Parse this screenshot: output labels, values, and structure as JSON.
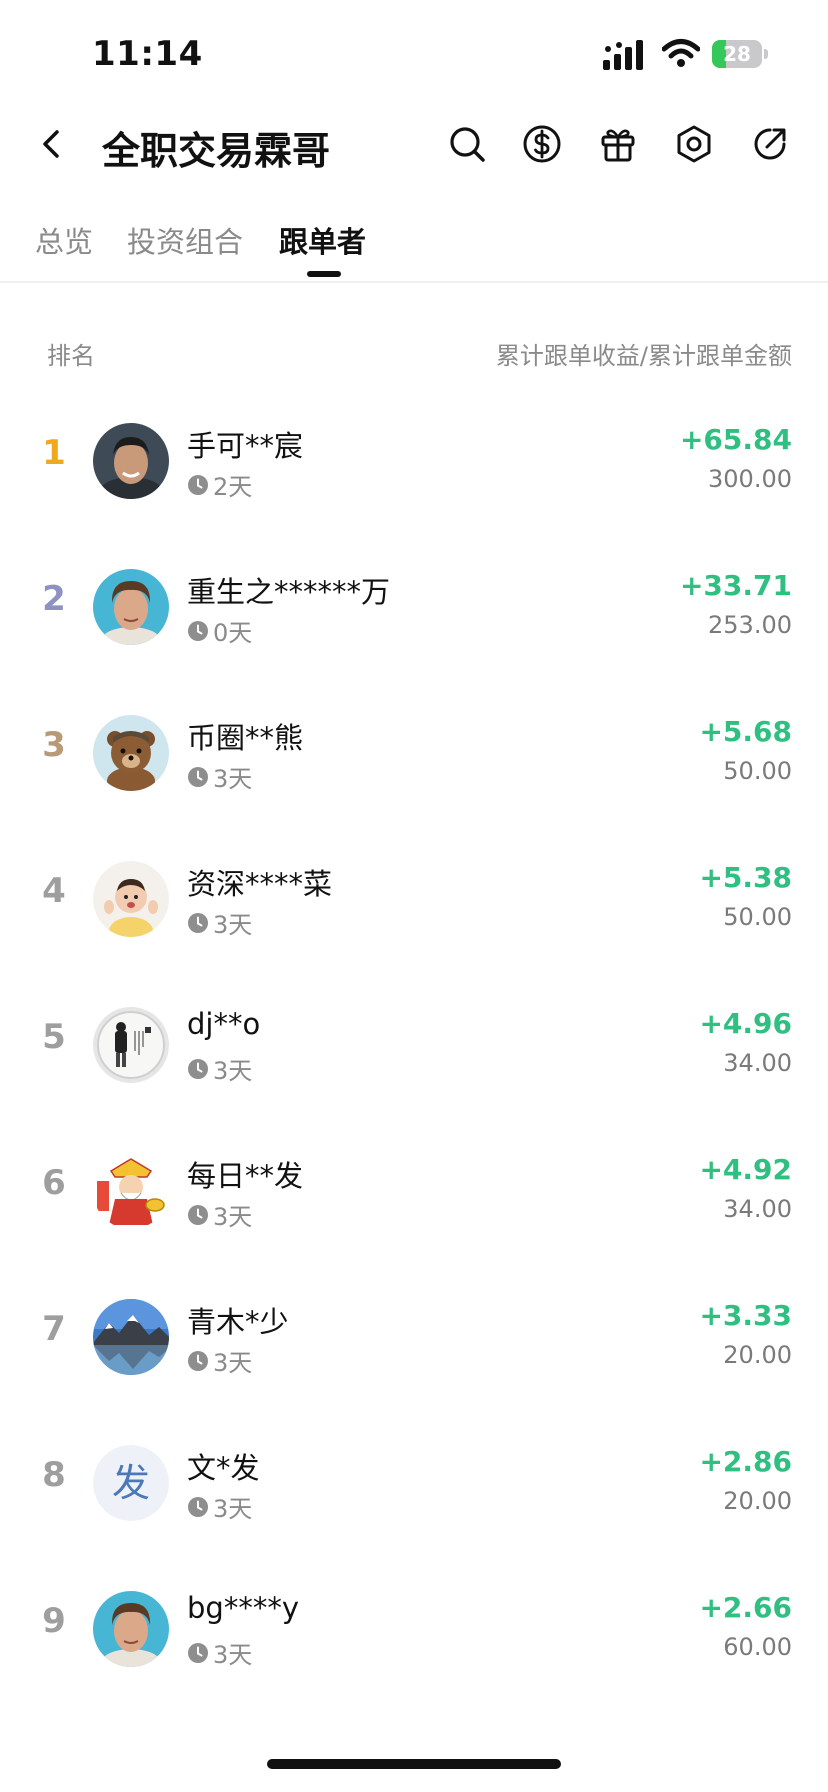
{
  "status_bar": {
    "time": "11:14",
    "battery_level": "28",
    "battery_fraction": 0.28,
    "battery_color": "#34c759",
    "icons": [
      "signal-icon",
      "wifi-icon",
      "battery-icon"
    ]
  },
  "header": {
    "title": "全职交易霖哥",
    "icons": [
      "back-icon",
      "search-icon",
      "dollar-icon",
      "gift-icon",
      "settings-icon",
      "share-icon"
    ]
  },
  "tabs": [
    {
      "label": "总览",
      "active": false
    },
    {
      "label": "投资组合",
      "active": false
    },
    {
      "label": "跟单者",
      "active": true
    }
  ],
  "list_header": {
    "left": "排名",
    "right": "累计跟单收益/累计跟单金额"
  },
  "colors": {
    "profit": "#2fbf80",
    "rank_1": "#f0a81e",
    "rank_2": "#8e92c2",
    "rank_3": "#b89a78",
    "rank_default": "#9e9e9e"
  },
  "followers": [
    {
      "rank": "1",
      "name": "手可**宸",
      "days": "2天",
      "profit": "+65.84",
      "amount": "300.00",
      "avatar": "man-photo"
    },
    {
      "rank": "2",
      "name": "重生之******万",
      "days": "0天",
      "profit": "+33.71",
      "amount": "253.00",
      "avatar": "young-man-photo"
    },
    {
      "rank": "3",
      "name": "币圈**熊",
      "days": "3天",
      "profit": "+5.68",
      "amount": "50.00",
      "avatar": "bear-cartoon"
    },
    {
      "rank": "4",
      "name": "资深****菜",
      "days": "3天",
      "profit": "+5.38",
      "amount": "50.00",
      "avatar": "baby-photo"
    },
    {
      "rank": "5",
      "name": "dj**o",
      "days": "3天",
      "profit": "+4.96",
      "amount": "34.00",
      "avatar": "ink-painting"
    },
    {
      "rank": "6",
      "name": "每日**发",
      "days": "3天",
      "profit": "+4.92",
      "amount": "34.00",
      "avatar": "fortune-god"
    },
    {
      "rank": "7",
      "name": "青木*少",
      "days": "3天",
      "profit": "+3.33",
      "amount": "20.00",
      "avatar": "mountain-lake"
    },
    {
      "rank": "8",
      "name": "文*发",
      "days": "3天",
      "profit": "+2.86",
      "amount": "20.00",
      "avatar": "text-avatar",
      "avatar_text": "发"
    },
    {
      "rank": "9",
      "name": "bg****y",
      "days": "3天",
      "profit": "+2.66",
      "amount": "60.00",
      "avatar": "young-man-photo"
    }
  ]
}
